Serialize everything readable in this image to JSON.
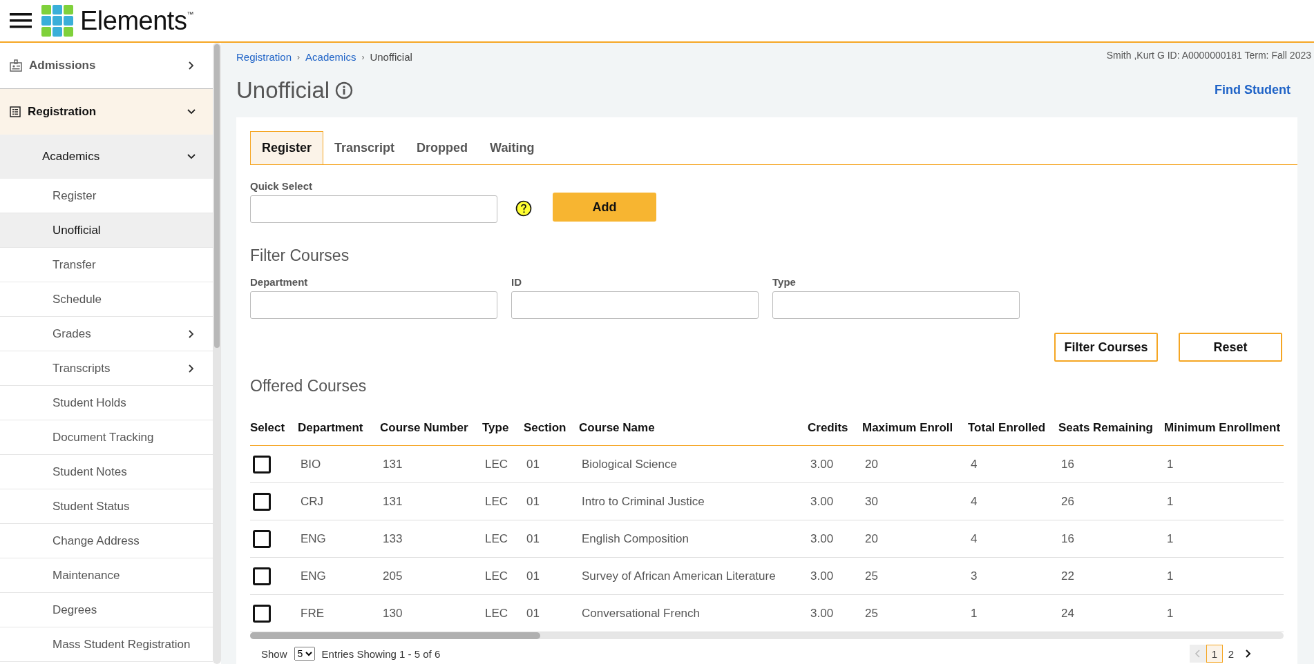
{
  "header": {
    "logo_text": "Elements$^{™}$"
  },
  "sidebar": {
    "items": [
      {
        "label": "Admissions",
        "expanded": false,
        "selected": false
      },
      {
        "label": "Registration",
        "expanded": true,
        "selected": true,
        "children": [
          {
            "label": "Academics",
            "expanded": true,
            "children": [
              {
                "label": "Register",
                "selected": false
              },
              {
                "label": "Unofficial",
                "selected": true
              },
              {
                "label": "Transfer",
                "selected": false
              },
              {
                "label": "Schedule",
                "selected": false
              },
              {
                "label": "Grades",
                "selected": false,
                "expanded": false
              },
              {
                "label": "Transcripts",
                "selected": false,
                "expanded": false
              },
              {
                "label": "Student Holds",
                "selected": false
              },
              {
                "label": "Document Tracking",
                "selected": false
              },
              {
                "label": "Student Notes",
                "selected": false
              },
              {
                "label": "Student Status",
                "selected": false
              },
              {
                "label": "Change Address",
                "selected": false
              },
              {
                "label": "Maintenance",
                "selected": false
              },
              {
                "label": "Degrees",
                "selected": false
              },
              {
                "label": "Mass Student Registration",
                "selected": false
              }
            ]
          }
        ]
      }
    ]
  },
  "breadcrumb": [
    {
      "label": "Registration",
      "kind": "link",
      "separator": "›"
    },
    {
      "label": "Academics",
      "kind": "link",
      "separator": "›"
    },
    {
      "label": "Unofficial",
      "kind": "current"
    }
  ],
  "student_info": "Smith ,Kurt G ID: A0000000181 Term: Fall 2023",
  "page_title": "Unofficial",
  "find_student": "Find Student",
  "tabs": [
    {
      "label": "Register",
      "selected": true
    },
    {
      "label": "Transcript",
      "selected": false
    },
    {
      "label": "Dropped",
      "selected": false
    },
    {
      "label": "Waiting",
      "selected": false
    }
  ],
  "quick_select": {
    "label": "Quick Select",
    "button": "Add"
  },
  "filter": {
    "title": "Filter Courses",
    "fields": [
      {
        "label": "Department"
      },
      {
        "label": "ID"
      },
      {
        "label": "Type"
      }
    ],
    "buttons": [
      "Filter Courses",
      "Reset"
    ]
  },
  "offered": {
    "title": "Offered Courses",
    "columns": [
      "Select",
      "Department",
      "Course Number",
      "Type",
      "Section",
      "Course Name",
      "Credits",
      "Maximum Enroll",
      "Total Enrolled",
      "Seats Remaining",
      "Minimum Enrollment"
    ],
    "rows": [
      {
        "checked": false,
        "department": "BIO",
        "course_number": "131",
        "type": "LEC",
        "section": "01",
        "course_name": "Biological Science",
        "credits": "3.00",
        "maximum_enroll": "20",
        "total_enrolled": "4",
        "seats_remaining": "16",
        "minimum_enrollment": "1"
      },
      {
        "checked": false,
        "department": "CRJ",
        "course_number": "131",
        "type": "LEC",
        "section": "01",
        "course_name": "Intro to Criminal Justice",
        "credits": "3.00",
        "maximum_enroll": "30",
        "total_enrolled": "4",
        "seats_remaining": "26",
        "minimum_enrollment": "1"
      },
      {
        "checked": false,
        "department": "ENG",
        "course_number": "133",
        "type": "LEC",
        "section": "01",
        "course_name": "English Composition",
        "credits": "3.00",
        "maximum_enroll": "20",
        "total_enrolled": "4",
        "seats_remaining": "16",
        "minimum_enrollment": "1"
      },
      {
        "checked": false,
        "department": "ENG",
        "course_number": "205",
        "type": "LEC",
        "section": "01",
        "course_name": "Survey of African American Literature",
        "credits": "3.00",
        "maximum_enroll": "25",
        "total_enrolled": "3",
        "seats_remaining": "22",
        "minimum_enrollment": "1"
      },
      {
        "checked": false,
        "department": "FRE",
        "course_number": "130",
        "type": "LEC",
        "section": "01",
        "course_name": "Conversational French",
        "credits": "3.00",
        "maximum_enroll": "25",
        "total_enrolled": "1",
        "seats_remaining": "24",
        "minimum_enrollment": "1"
      }
    ]
  },
  "footer": {
    "show_label": "Show",
    "page_size": "5",
    "entries_text": "Entries Showing 1 - 5 of 6",
    "pagination": {
      "prev_disabled": true,
      "pages": [
        {
          "label": "1",
          "selected": true
        },
        {
          "label": "2",
          "selected": false
        }
      ]
    }
  }
}
